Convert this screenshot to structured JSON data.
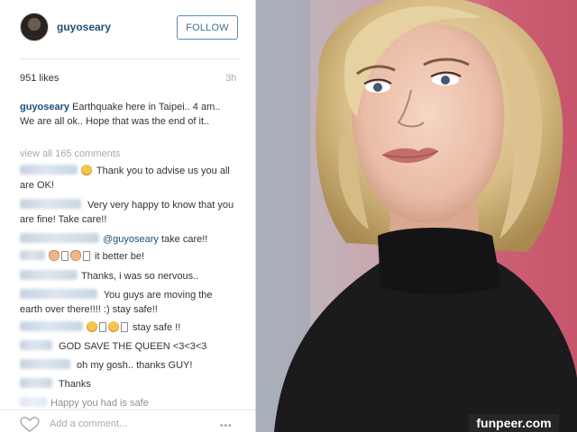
{
  "post": {
    "username": "guyoseary",
    "follow_label": "FOLLOW",
    "likes": "951 likes",
    "time_ago": "3h",
    "caption_user": "guyoseary",
    "caption_text": " Earthquake here in Taipei.. 4 am.. We are all ok.. Hope that was the end of it..",
    "view_all_comments": "view all 165 comments",
    "comments": [
      {
        "text": " Thank you to advise us you all are OK!"
      },
      {
        "text": " Very very happy to know that you are fine! Take care!!"
      },
      {
        "mention": "@guyoseary",
        "text": " take care!!"
      },
      {
        "text": " it better be!"
      },
      {
        "text": "Thanks, i was so nervous.."
      },
      {
        "text": " You guys are moving the earth over there!!!! :) stay safe!!"
      },
      {
        "text": " stay safe !!"
      },
      {
        "text": " GOD SAVE THE QUEEN <3<3<3"
      },
      {
        "text": " oh my gosh.. thanks GUY!"
      },
      {
        "text": " Thanks"
      },
      {
        "text": "Happy you had is safe"
      }
    ],
    "add_comment_placeholder": "Add a comment...",
    "more_label": "•••",
    "icons": {
      "avatar": "avatar",
      "like": "heart-icon",
      "more": "ellipsis-icon"
    }
  },
  "watermark": "funpeer.com",
  "colors": {
    "link_blue": "#3f729b",
    "username_blue": "#1e4e79",
    "follow_border": "#5d8bb5",
    "watermark_bg": "#262626"
  }
}
